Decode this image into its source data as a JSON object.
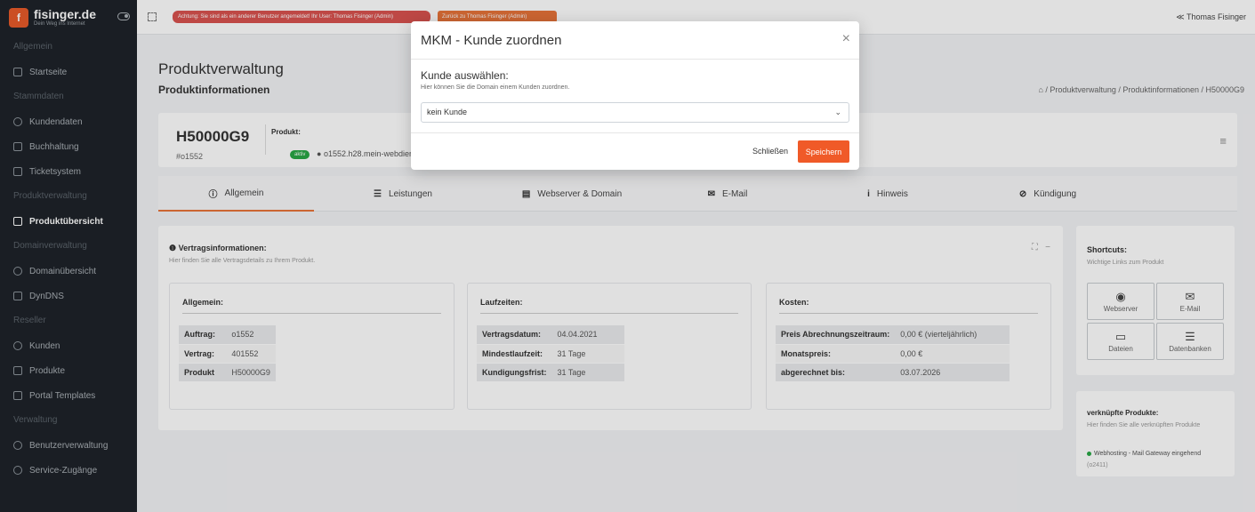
{
  "brand": {
    "name": "fisinger.de",
    "tagline": "Dein Weg ins Internet"
  },
  "sidebar": {
    "sections": [
      {
        "title": "Allgemein",
        "items": [
          "Startseite"
        ]
      },
      {
        "title": "Stammdaten",
        "items": [
          "Kundendaten",
          "Buchhaltung",
          "Ticketsystem"
        ]
      },
      {
        "title": "Produktverwaltung",
        "items": [
          "Produktübersicht"
        ]
      },
      {
        "title": "Domainverwaltung",
        "items": [
          "Domainübersicht",
          "DynDNS"
        ]
      },
      {
        "title": "Reseller",
        "items": [
          "Kunden",
          "Produkte",
          "Portal Templates"
        ]
      },
      {
        "title": "Verwaltung",
        "items": [
          "Benutzerverwaltung",
          "Service-Zugänge"
        ]
      }
    ],
    "active_item": "Produktübersicht"
  },
  "topbar": {
    "warning": "Achtung: Sie sind als ein anderer Benutzer angemeldet! Ihr User: Thomas Fisinger (Admin)",
    "back_button": "Zurück zu Thomas Fisinger (Admin)",
    "user": "Thomas Fisinger"
  },
  "page": {
    "title": "Produktverwaltung",
    "subtitle": "Produktinformationen",
    "breadcrumb": "/ Produktverwaltung / Produktinformationen / H50000G9"
  },
  "product": {
    "id": "H50000G9",
    "number": "#o1552",
    "label": "Produkt:",
    "status": "aktiv",
    "host": "o1552.h28.mein-webdienst.de"
  },
  "tabs": [
    "Allgemein",
    "Leistungen",
    "Webserver & Domain",
    "E-Mail",
    "Hinweis",
    "Kündigung"
  ],
  "contract": {
    "title": "Vertragsinformationen:",
    "desc": "Hier finden Sie alle Vertragsdetails zu Ihrem Produkt.",
    "allgemein": {
      "title": "Allgemein:",
      "rows": [
        [
          "Auftrag:",
          "o1552"
        ],
        [
          "Vertrag:",
          "401552"
        ],
        [
          "Produkt",
          "H50000G9"
        ]
      ]
    },
    "laufzeiten": {
      "title": "Laufzeiten:",
      "rows": [
        [
          "Vertragsdatum:",
          "04.04.2021"
        ],
        [
          "Mindestlaufzeit:",
          "31 Tage"
        ],
        [
          "Kundigungsfrist:",
          "31 Tage"
        ]
      ]
    },
    "kosten": {
      "title": "Kosten:",
      "rows": [
        [
          "Preis Abrechnungszeitraum:",
          "0,00 € (vierteljährlich)"
        ],
        [
          "Monatspreis:",
          "0,00 €"
        ],
        [
          "abgerechnet bis:",
          "03.07.2026"
        ]
      ]
    }
  },
  "shortcuts": {
    "title": "Shortcuts:",
    "desc": "Wichtige Links zum Produkt",
    "buttons": [
      "Webserver",
      "E-Mail",
      "Dateien",
      "Datenbanken"
    ]
  },
  "linked": {
    "title": "verknüpfte Produkte:",
    "desc": "Hier finden Sie alle verknüpften Produkte",
    "item": "Webhosting - Mail Gateway eingehend",
    "ref": "(o2411)"
  },
  "modal": {
    "title": "MKM - Kunde zuordnen",
    "close": "×",
    "label": "Kunde auswählen:",
    "help": "Hier können Sie die Domain einem Kunden zuordnen.",
    "selected": "kein Kunde",
    "btn_close": "Schließen",
    "btn_save": "Speichern"
  },
  "colors": {
    "accent": "#f05a28",
    "sidebar": "#1e2329",
    "success": "#28a745",
    "danger": "#d9534f"
  }
}
